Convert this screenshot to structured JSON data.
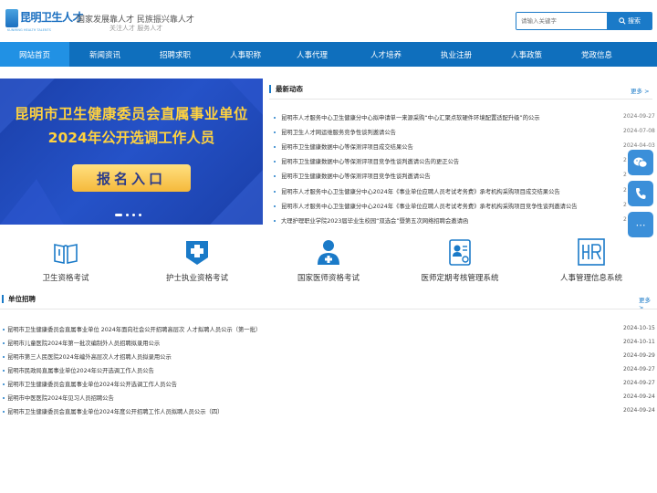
{
  "header": {
    "logo_text": "昆明卫生人才",
    "logo_sub": "KUNMING HEALTH TALENTS",
    "slogan_main": "国家发展靠人才 民族振兴靠人才",
    "slogan_sub": "关注人才 服务人才",
    "search_placeholder": "请输入关键字",
    "search_button": "搜索"
  },
  "nav": {
    "items": [
      "网站首页",
      "新闻资讯",
      "招聘求职",
      "人事职称",
      "人事代理",
      "人才培养",
      "执业注册",
      "人事政策",
      "党政信息"
    ],
    "active_index": 0
  },
  "banner": {
    "line1": "昆明市卫生健康委员会直属事业单位",
    "line2": "2024年公开选调工作人员",
    "button": "报名入口",
    "slide_count": 4,
    "active_slide": 0
  },
  "news": {
    "title": "最新动态",
    "more": "更多 >",
    "items": [
      {
        "title": "昆明市人才服务中心卫生健康分中心拟申请单一来源采购“中心汇聚点软硬件环境配置适配升级”的公示",
        "date": "2024-09-27"
      },
      {
        "title": "昆明卫生人才网运维服务竞争性谈判邀请公告",
        "date": "2024-07-08"
      },
      {
        "title": "昆明市卫生健康数据中心等保测评项目成交结果公告",
        "date": "2024-04-03"
      },
      {
        "title": "昆明市卫生健康数据中心等保测评项目竞争性谈判邀请公告的更正公告",
        "date": "2"
      },
      {
        "title": "昆明市卫生健康数据中心等保测评项目竞争性谈判邀请公告",
        "date": "2"
      },
      {
        "title": "昆明市人才服务中心卫生健康分中心2024年《事业单位应聘人员考试考务费》承考机构采购项目成交结果公告",
        "date": "2"
      },
      {
        "title": "昆明市人才服务中心卫生健康分中心2024年《事业单位应聘人员考试考务费》承考机构采购项目竞争性谈判邀请公告",
        "date": "2"
      },
      {
        "title": "大理护理职业学院2023届毕业生校园“双选会”暨第五次网络招聘会邀请函",
        "date": "2"
      }
    ]
  },
  "services": [
    {
      "label": "卫生资格考试",
      "icon": "book-icon"
    },
    {
      "label": "护士执业资格考试",
      "icon": "medical-cross-icon"
    },
    {
      "label": "国家医师资格考试",
      "icon": "doctor-icon"
    },
    {
      "label": "医师定期考核管理系统",
      "icon": "certificate-icon"
    },
    {
      "label": "人事管理信息系统",
      "icon": "hr-icon"
    }
  ],
  "recruit": {
    "title": "单位招聘",
    "more": "更多 >",
    "items": [
      {
        "title": "昆明市卫生健康委员会直属事业单位 2024年面向社会公开招聘高层次 人才拟聘人员公示（第一批）",
        "date": "2024-10-15"
      },
      {
        "title": "昆明市儿童医院2024年第一批次编制外人员招聘拟录用公示",
        "date": "2024-10-11"
      },
      {
        "title": "昆明市第三人民医院2024年编外高层次人才招聘人员拟录用公示",
        "date": "2024-09-29"
      },
      {
        "title": "昆明市民政局直属事业单位2024年公开选调工作人员公告",
        "date": "2024-09-27"
      },
      {
        "title": "昆明市卫生健康委员会直属事业单位2024年公开选调工作人员公告",
        "date": "2024-09-27"
      },
      {
        "title": "昆明市中医医院2024年见习人员招聘公告",
        "date": "2024-09-24"
      },
      {
        "title": "昆明市卫生健康委员会直属事业单位2024年度公开招聘工作人员拟聘人员公示（四）",
        "date": "2024-09-24"
      }
    ]
  },
  "float_buttons": [
    {
      "name": "wechat-icon"
    },
    {
      "name": "phone-icon"
    },
    {
      "name": "more-icon",
      "glyph": "⋯"
    }
  ],
  "colors": {
    "nav_bg": "#0f6fbd",
    "nav_active": "#2191e4",
    "accent": "#1a7ac8",
    "banner_bg": "#1a3fa8",
    "banner_text": "#ffd23f"
  }
}
